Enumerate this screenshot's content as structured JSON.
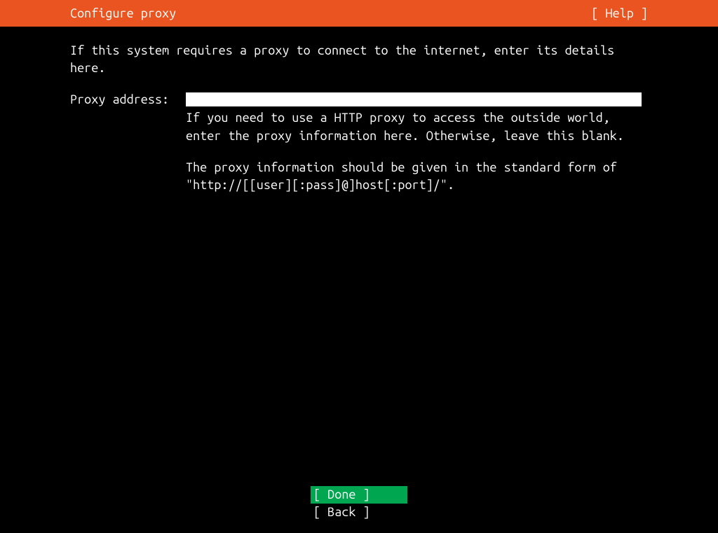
{
  "header": {
    "title": "Configure proxy",
    "help": "[ Help ]"
  },
  "description": "If this system requires a proxy to connect to the internet, enter its details here.",
  "form": {
    "label": "Proxy address:",
    "value": "",
    "hint1": "If you need to use a HTTP proxy to access the outside world, enter the proxy information here. Otherwise, leave this blank.",
    "hint2": "The proxy information should be given in the standard form of \"http://[[user][:pass]@]host[:port]/\"."
  },
  "buttons": {
    "done": "[ Done       ]",
    "back": "[ Back       ]"
  }
}
